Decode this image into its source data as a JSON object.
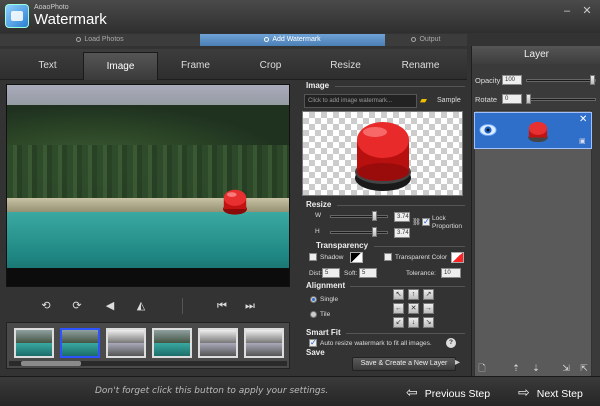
{
  "app": {
    "brand_sub": "AoaoPhoto",
    "brand_main": "Watermark",
    "colors": {
      "accent": "#2f6fc9",
      "step_active": "#5a8fc7",
      "button_red": "#e02020"
    }
  },
  "steps": [
    "Load Photos",
    "Add Watermark",
    "Output"
  ],
  "tabs": [
    "Text",
    "Image",
    "Frame",
    "Crop",
    "Resize",
    "Rename"
  ],
  "image_section": {
    "title": "Image",
    "input_placeholder": "Click to add image watermark...",
    "sample_label": "Sample"
  },
  "resize_section": {
    "title": "Resize",
    "w_label": "W",
    "h_label": "H",
    "w_value": "3.74",
    "h_value": "3.74",
    "lock_label": "Lock\nProportion"
  },
  "transparency_section": {
    "title": "Transparency",
    "shadow_label": "Shadow",
    "transparent_color_label": "Transparent Color",
    "dist_label": "Dist:",
    "dist_value": "5",
    "soft_label": "Soft:",
    "soft_value": "5",
    "tolerance_label": "Tolerance:",
    "tolerance_value": "10"
  },
  "alignment_section": {
    "title": "Alignment",
    "single_label": "Single",
    "tile_label": "Tile",
    "arrows": [
      "↖",
      "↑",
      "↗",
      "←",
      "✕",
      "→",
      "↙",
      "↓",
      "↘"
    ]
  },
  "smartfit_section": {
    "title": "Smart Fit",
    "auto_resize_label": "Auto resize watermark to fit all images."
  },
  "save_section": {
    "title": "Save",
    "save_button_label": "Save & Create a New Layer"
  },
  "layer_panel": {
    "title": "Layer",
    "opacity_label": "Opacity",
    "opacity_value": "100",
    "rotate_label": "Rotate",
    "rotate_value": "0"
  },
  "bottom": {
    "hint": "Don't forget click this button to apply your settings.",
    "previous": "Previous Step",
    "next": "Next Step"
  },
  "controls": {
    "rotate_left": "⟲",
    "rotate_right": "⟳",
    "flip_h": "◀",
    "flip_v": "◭",
    "prev": "⏮",
    "next": "⏭"
  }
}
